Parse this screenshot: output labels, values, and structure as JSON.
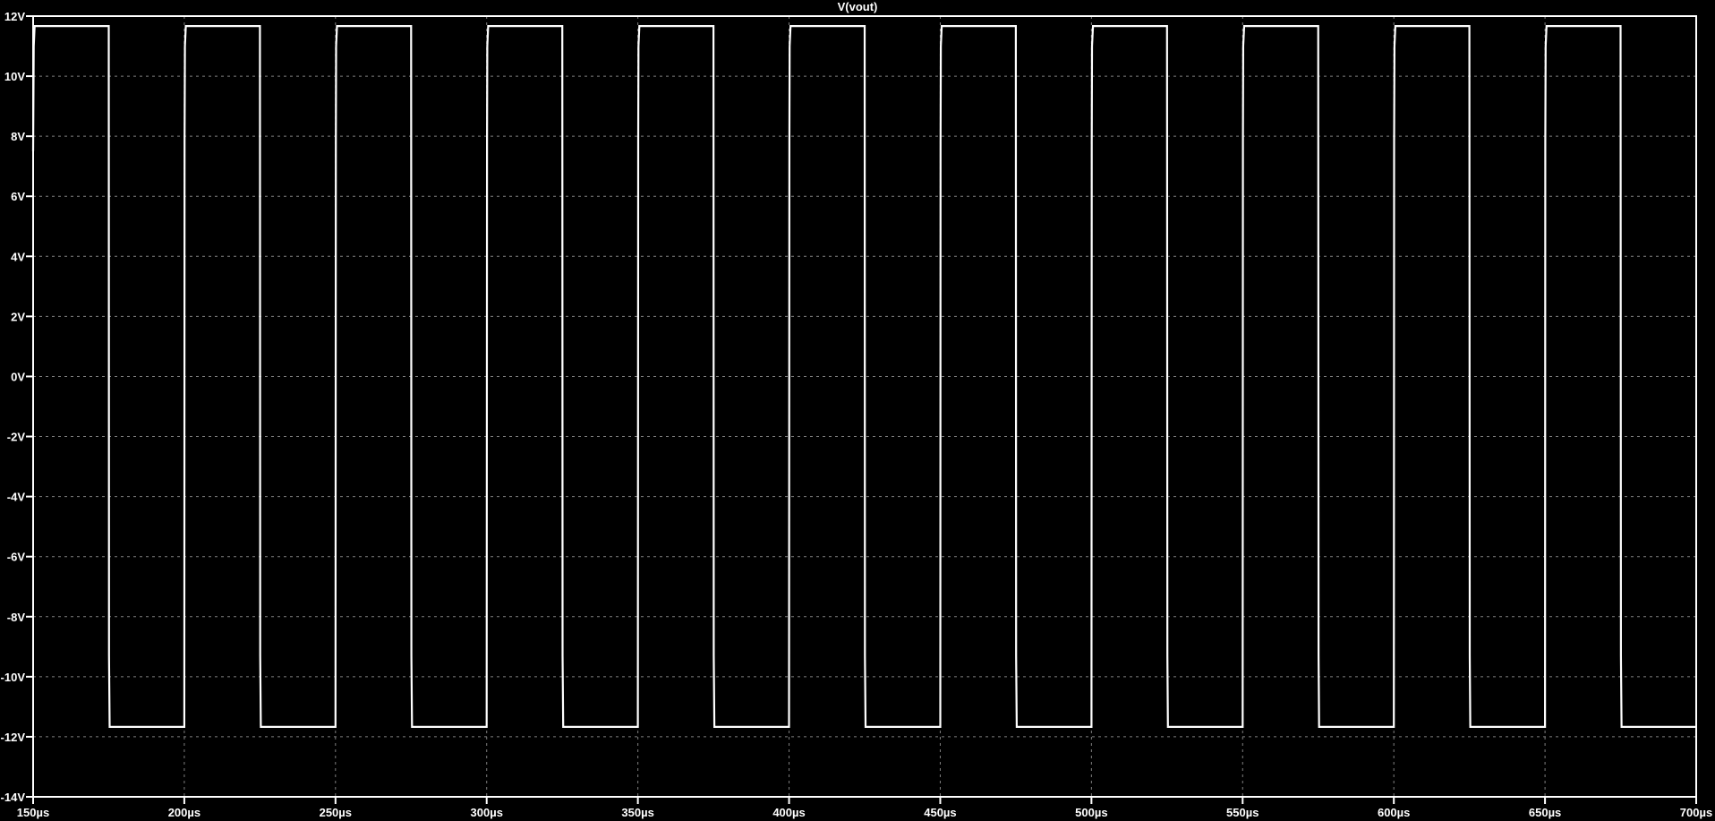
{
  "chart_data": {
    "type": "line",
    "title": "V(vout)",
    "xlabel": "",
    "ylabel": "",
    "xlim": [
      150,
      700
    ],
    "ylim": [
      -14,
      12
    ],
    "x_ticks": [
      150,
      200,
      250,
      300,
      350,
      400,
      450,
      500,
      550,
      600,
      650,
      700
    ],
    "x_tick_labels": [
      "150µs",
      "200µs",
      "250µs",
      "300µs",
      "350µs",
      "400µs",
      "450µs",
      "500µs",
      "550µs",
      "600µs",
      "650µs",
      "700µs"
    ],
    "y_ticks": [
      12,
      10,
      8,
      6,
      4,
      2,
      0,
      -2,
      -4,
      -6,
      -8,
      -10,
      -12,
      -14
    ],
    "y_tick_labels": [
      "12V",
      "10V",
      "8V",
      "6V",
      "4V",
      "2V",
      "0V",
      "-2V",
      "-4V",
      "-6V",
      "-8V",
      "-10V",
      "-12V",
      "-14V"
    ],
    "grid": true,
    "colors": {
      "background": "#000000",
      "trace": "#ffffff",
      "grid": "#808080"
    },
    "series": [
      {
        "name": "V(vout)",
        "points": [
          [
            150,
            7.5
          ],
          [
            150.2,
            11.0
          ],
          [
            150.5,
            11.67
          ],
          [
            175,
            11.67
          ],
          [
            175.1,
            -9.3
          ],
          [
            175.3,
            -11.67
          ],
          [
            200,
            -11.67
          ],
          [
            200.1,
            7.8
          ],
          [
            200.2,
            11.0
          ],
          [
            200.5,
            11.67
          ],
          [
            225,
            11.67
          ],
          [
            225.1,
            -9.3
          ],
          [
            225.3,
            -11.67
          ],
          [
            250,
            -11.67
          ],
          [
            250.1,
            7.8
          ],
          [
            250.2,
            11.0
          ],
          [
            250.5,
            11.67
          ],
          [
            275,
            11.67
          ],
          [
            275.1,
            -9.3
          ],
          [
            275.3,
            -11.67
          ],
          [
            300,
            -11.67
          ],
          [
            300.1,
            7.8
          ],
          [
            300.2,
            11.0
          ],
          [
            300.5,
            11.67
          ],
          [
            325,
            11.67
          ],
          [
            325.1,
            -9.3
          ],
          [
            325.3,
            -11.67
          ],
          [
            350,
            -11.67
          ],
          [
            350.1,
            7.8
          ],
          [
            350.2,
            11.0
          ],
          [
            350.5,
            11.67
          ],
          [
            375,
            11.67
          ],
          [
            375.1,
            -9.3
          ],
          [
            375.3,
            -11.67
          ],
          [
            400,
            -11.67
          ],
          [
            400.1,
            7.8
          ],
          [
            400.2,
            11.0
          ],
          [
            400.5,
            11.67
          ],
          [
            425,
            11.67
          ],
          [
            425.1,
            -9.3
          ],
          [
            425.3,
            -11.67
          ],
          [
            450,
            -11.67
          ],
          [
            450.1,
            7.8
          ],
          [
            450.2,
            11.0
          ],
          [
            450.5,
            11.67
          ],
          [
            475,
            11.67
          ],
          [
            475.1,
            -9.3
          ],
          [
            475.3,
            -11.67
          ],
          [
            500,
            -11.67
          ],
          [
            500.1,
            7.8
          ],
          [
            500.2,
            11.0
          ],
          [
            500.5,
            11.67
          ],
          [
            525,
            11.67
          ],
          [
            525.1,
            -9.3
          ],
          [
            525.3,
            -11.67
          ],
          [
            550,
            -11.67
          ],
          [
            550.1,
            7.8
          ],
          [
            550.2,
            11.0
          ],
          [
            550.5,
            11.67
          ],
          [
            575,
            11.67
          ],
          [
            575.1,
            -9.3
          ],
          [
            575.3,
            -11.67
          ],
          [
            600,
            -11.67
          ],
          [
            600.1,
            7.8
          ],
          [
            600.2,
            11.0
          ],
          [
            600.5,
            11.67
          ],
          [
            625,
            11.67
          ],
          [
            625.1,
            -9.3
          ],
          [
            625.3,
            -11.67
          ],
          [
            650,
            -11.67
          ],
          [
            650.1,
            7.8
          ],
          [
            650.2,
            11.0
          ],
          [
            650.5,
            11.67
          ],
          [
            675,
            11.67
          ],
          [
            675.1,
            -9.3
          ],
          [
            675.3,
            -11.67
          ],
          [
            700,
            -11.67
          ]
        ]
      }
    ]
  }
}
